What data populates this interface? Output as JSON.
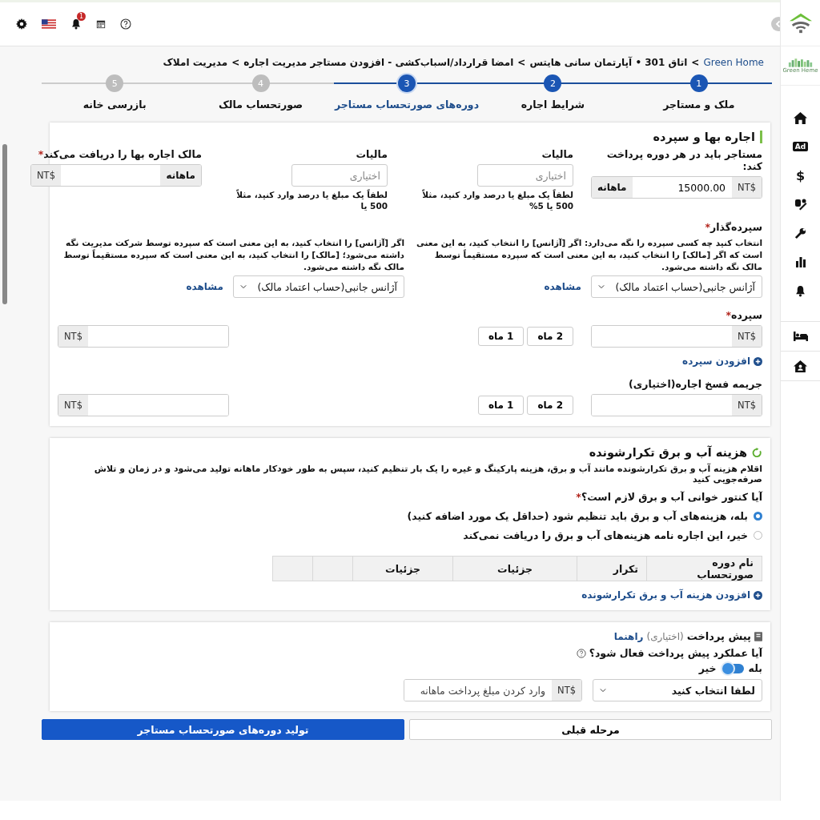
{
  "top_bar": {
    "notification_count": "1"
  },
  "sidebar": {
    "logo_text": "Green Heme",
    "items": [
      {
        "kind": "home"
      },
      {
        "kind": "ad",
        "label": "Ad"
      },
      {
        "kind": "dollar",
        "label": "$"
      },
      {
        "kind": "tools"
      },
      {
        "kind": "wrench"
      },
      {
        "kind": "chart"
      },
      {
        "kind": "bell"
      },
      {
        "kind": "bed"
      },
      {
        "kind": "house"
      }
    ]
  },
  "breadcrumb": {
    "separator": ">",
    "items": [
      "Green Home",
      "اتاق 301 • آپارتمان سانی هایتس",
      "امضا قرارداد/اسباب‌کشی - افزودن مستاجر مدیریت اجاره",
      "مدیریت املاک"
    ]
  },
  "steps": [
    {
      "number": "1",
      "label": "ملک و مستاجر",
      "completed": true,
      "selected": false
    },
    {
      "number": "2",
      "label": "شرایط اجاره",
      "completed": true,
      "selected": false
    },
    {
      "number": "3",
      "label": "دوره‌های صورتحساب مستاجر",
      "completed": false,
      "selected": true
    },
    {
      "number": "4",
      "label": "صورتحساب مالک",
      "completed": false,
      "selected": false
    },
    {
      "number": "5",
      "label": "بازرسی خانه",
      "completed": false,
      "selected": false
    }
  ],
  "required_mark": "*",
  "rent_section": {
    "title": "اجاره بها و سپرده",
    "tenant_payment": {
      "label": "مستاجر باید در هر دوره پرداخت کند:",
      "currency": "NT$",
      "value": "15000.00",
      "period": "ماهانه"
    },
    "taxes": [
      {
        "label": "مالیات",
        "placeholder": "اختیاری",
        "hint": "لطفاً یک مبلغ یا درصد وارد کنید، مثلاً 500 یا 5%"
      },
      {
        "label": "مالیات",
        "placeholder": "اختیاری",
        "hint": "لطفاً یک مبلغ یا درصد وارد کنید، مثلاً 500 یا"
      }
    ],
    "landlord_receives": {
      "label": "مالک اجاره بها را دریافت می‌کند",
      "required": true,
      "currency": "NT$",
      "period": "ماهانه"
    },
    "depositor": {
      "label": "سپرده‌گذار",
      "required": true,
      "options": [
        {
          "description": "انتخاب کنید چه کسی سپرده را نگه می‌دارد: اگر [آژانس] را انتخاب کنید، به این معنی است که اگر [مالک] را انتخاب کنید، به این معنی است که سپرده مستقیماً توسط مالک نگه داشته می‌شود.",
          "value": "آژانس جانبی(حساب اعتماد مالک)",
          "link": "مشاهده"
        },
        {
          "description": "اگر [آژانس] را انتخاب کنید، به این معنی است که سپرده توسط شرکت مدیریت نگه داشته می‌شود؛ [مالک] را انتخاب کنید، به این معنی است که سپرده مستقیماً توسط مالک نگه داشته می‌شود.",
          "value": "آژانس جانبی(حساب اعتماد مالک)",
          "link": "مشاهده"
        }
      ]
    },
    "amount_rows": [
      {
        "label": "سپرده",
        "required": true,
        "currency": "NT$",
        "month_buttons": [
          "2 ماه",
          "1 ماه"
        ],
        "other_currency": "NT$",
        "add_link": "افزودن سپرده"
      },
      {
        "label": "جریمه فسخ اجاره(اختیاری)",
        "required": false,
        "currency": "NT$",
        "month_buttons": [
          "2 ماه",
          "1 ماه"
        ],
        "other_currency": "NT$"
      }
    ]
  },
  "utilities_section": {
    "title": "هزینه آب و برق تکرارشونده",
    "description": "اقلام هزینه آب و برق تکرارشونده مانند آب و برق، هزینه پارکینگ و غیره را یک بار تنظیم کنید، سپس به طور خودکار ماهانه تولید می‌شود و در زمان و تلاش صرفه‌جویی کنید",
    "question": "آیا کنتور خوانی آب و برق لازم است؟",
    "required": true,
    "options": [
      {
        "label": "بله، هزینه‌های آب و برق باید تنظیم شود (حداقل یک مورد اضافه کنید)",
        "selected": true
      },
      {
        "label": "خیر، این اجاره نامه هزینه‌های آب و برق را دریافت نمی‌کند",
        "selected": false
      }
    ],
    "table": {
      "columns": [
        "نام دوره صورتحساب",
        "تکرار",
        "جزئیات",
        "جزئیات"
      ]
    },
    "add_link": "افزودن هزینه آب و برق تکرارشونده"
  },
  "prepayment_section": {
    "title": "پیش پرداخت",
    "optional": "(اختیاری)",
    "help_link": "راهنما",
    "question": "آیا عملکرد پیش پرداخت فعال شود؟",
    "toggle": {
      "on_label": "بله",
      "off_label": "خیر",
      "on": false
    },
    "select": {
      "value": "لطفا انتخاب کنید"
    },
    "amount": {
      "currency": "NT$",
      "placeholder": "وارد کردن مبلغ پرداخت ماهانه"
    }
  },
  "actions": [
    {
      "label": "مرحله قبلی",
      "kind": "secondary"
    },
    {
      "label": "تولید دوره‌های صورتحساب مستاجر",
      "kind": "primary"
    }
  ]
}
